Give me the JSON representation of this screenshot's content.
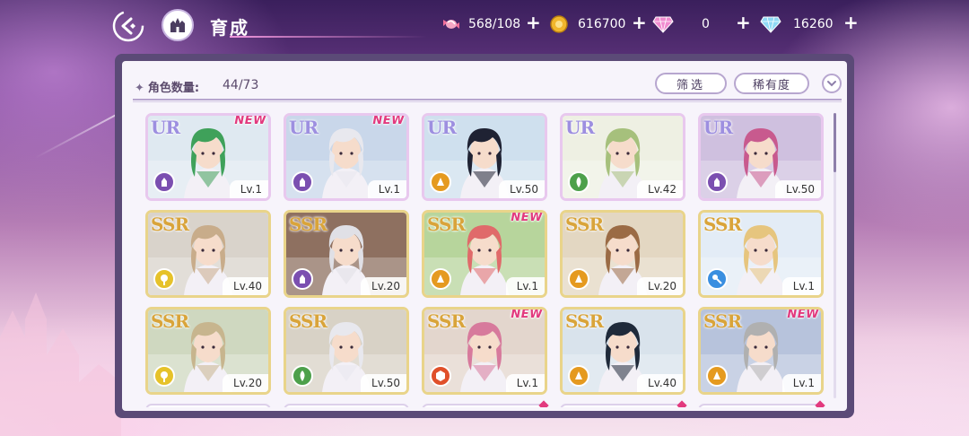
{
  "header": {
    "title": "育成",
    "title_deco": "Room"
  },
  "resources": [
    {
      "icon": "candy-icon",
      "value": "568/108"
    },
    {
      "icon": "gold-coin-icon",
      "value": "616700"
    },
    {
      "icon": "pink-diamond-icon",
      "value": "0"
    },
    {
      "icon": "blue-diamond-icon",
      "value": "16260"
    }
  ],
  "panel": {
    "count_label": "角色数量:",
    "count_value": "44/73",
    "filter_label": "筛选",
    "sort_label": "稀有度"
  },
  "colors": {
    "ur_badge": "#9d8fe0",
    "ssr_badge": "#d9a43a",
    "new_tag": "#e23a7e",
    "attr_purple": "#7b4fb0",
    "attr_orange": "#e59a1f",
    "attr_green": "#4da04b",
    "attr_yellow": "#e6c22a",
    "attr_blue": "#3a8fe0",
    "attr_red": "#e0502a"
  },
  "cards": [
    {
      "rarity": "UR",
      "new": "NEW",
      "level": "Lv.1",
      "attr": "purple",
      "hair": "#3fa15a",
      "bg": "#dfe9f1"
    },
    {
      "rarity": "UR",
      "new": "NEW",
      "level": "Lv.1",
      "attr": "purple",
      "hair": "#e8e8ee",
      "bg": "#c9d7ea"
    },
    {
      "rarity": "UR",
      "new": "",
      "level": "Lv.50",
      "attr": "orange",
      "hair": "#1f2233",
      "bg": "#cfe0ee"
    },
    {
      "rarity": "UR",
      "new": "",
      "level": "Lv.42",
      "attr": "green",
      "hair": "#a6c07c",
      "bg": "#eef0e3"
    },
    {
      "rarity": "UR",
      "new": "",
      "level": "Lv.50",
      "attr": "purple",
      "hair": "#c85a8e",
      "bg": "#cfc0df"
    },
    {
      "rarity": "SSR",
      "new": "",
      "level": "Lv.40",
      "attr": "yellow",
      "hair": "#c8ac8a",
      "bg": "#d9d3cb"
    },
    {
      "rarity": "SSR",
      "new": "",
      "level": "Lv.20",
      "attr": "purple",
      "hair": "#e0e0e6",
      "bg": "#8e7060"
    },
    {
      "rarity": "SSR",
      "new": "NEW",
      "level": "Lv.1",
      "attr": "orange",
      "hair": "#e06a6a",
      "bg": "#b7d59c"
    },
    {
      "rarity": "SSR",
      "new": "",
      "level": "Lv.20",
      "attr": "orange",
      "hair": "#9b6b45",
      "bg": "#e3d7c2"
    },
    {
      "rarity": "SSR",
      "new": "",
      "level": "Lv.1",
      "attr": "blue",
      "hair": "#e6c57e",
      "bg": "#e3ecf6"
    },
    {
      "rarity": "SSR",
      "new": "",
      "level": "Lv.20",
      "attr": "yellow",
      "hair": "#c7b58e",
      "bg": "#cfd8c0"
    },
    {
      "rarity": "SSR",
      "new": "",
      "level": "Lv.50",
      "attr": "green",
      "hair": "#e8e8ee",
      "bg": "#d8d2c6"
    },
    {
      "rarity": "SSR",
      "new": "NEW",
      "level": "Lv.1",
      "attr": "red",
      "hair": "#d77a9c",
      "bg": "#e3d6cd"
    },
    {
      "rarity": "SSR",
      "new": "",
      "level": "Lv.40",
      "attr": "orange",
      "hair": "#1f2a3a",
      "bg": "#d9e3ec"
    },
    {
      "rarity": "SSR",
      "new": "NEW",
      "level": "Lv.1",
      "attr": "orange",
      "hair": "#b0b0b0",
      "bg": "#b7c3dc"
    }
  ]
}
